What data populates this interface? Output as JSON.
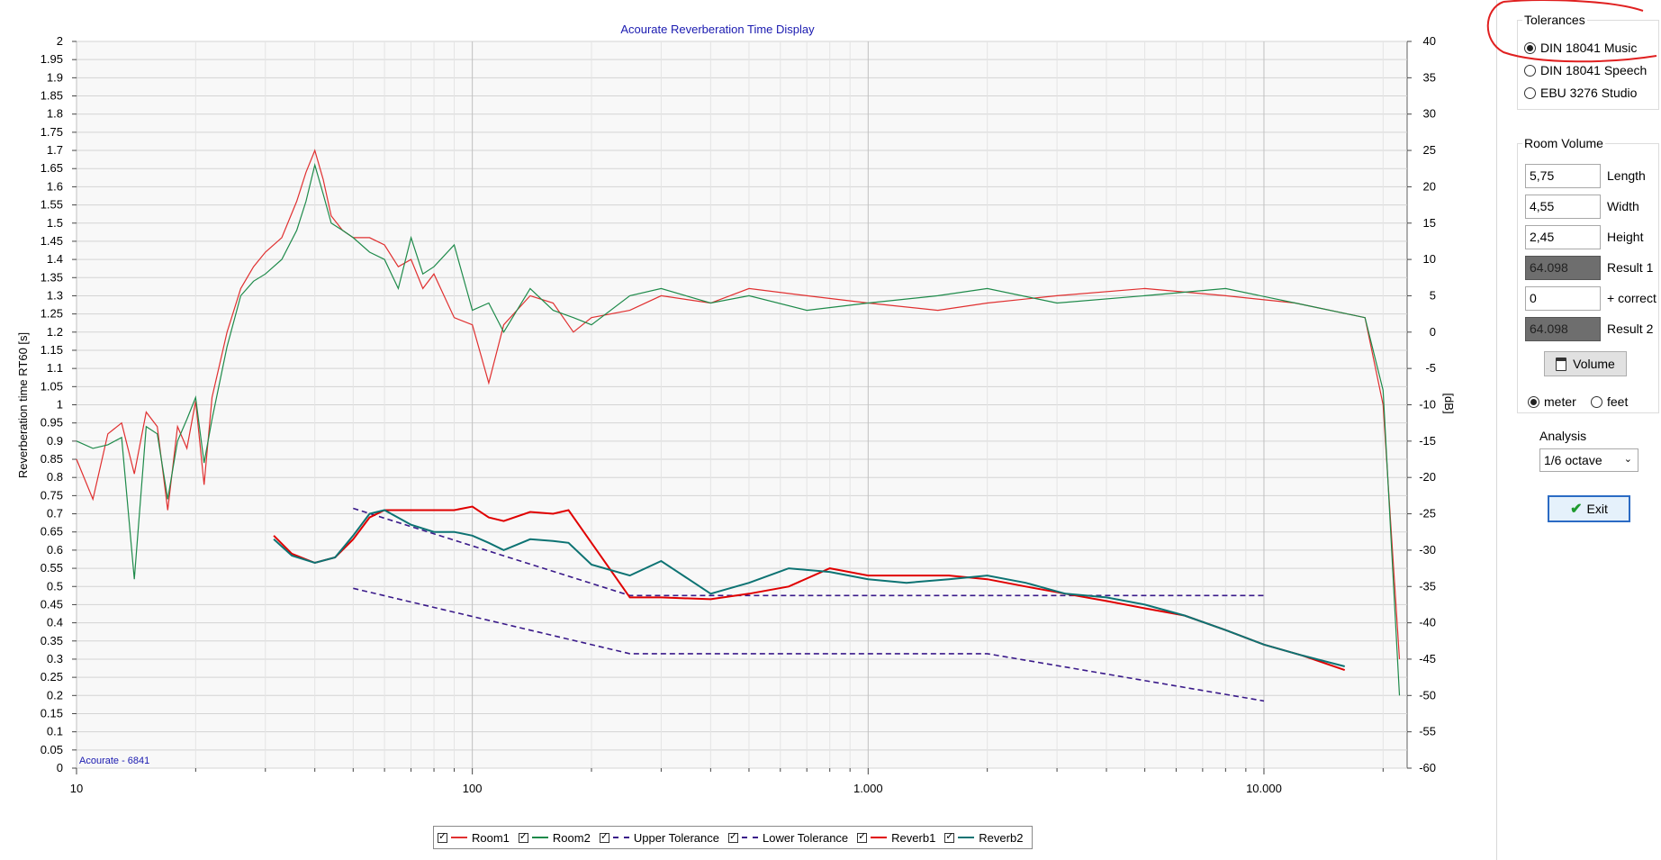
{
  "chart_data": {
    "type": "line",
    "title": "Acourate Reverberation Time Display",
    "watermark": "Acourate - 6841",
    "xscale": "log",
    "xlim": [
      10,
      23000
    ],
    "x_ticks": [
      10,
      100,
      1000,
      10000
    ],
    "x_tick_labels": [
      "10",
      "100",
      "1.000",
      "10.000"
    ],
    "ylabel": "Reverberation time RT60 [s]",
    "ylim": [
      0,
      2
    ],
    "y_ticks": [
      "0",
      "0.05",
      "0.1",
      "0.15",
      "0.2",
      "0.25",
      "0.3",
      "0.35",
      "0.4",
      "0.45",
      "0.5",
      "0.55",
      "0.6",
      "0.65",
      "0.7",
      "0.75",
      "0.8",
      "0.85",
      "0.9",
      "0.95",
      "1",
      "1.05",
      "1.1",
      "1.15",
      "1.2",
      "1.25",
      "1.3",
      "1.35",
      "1.4",
      "1.45",
      "1.5",
      "1.55",
      "1.6",
      "1.65",
      "1.7",
      "1.75",
      "1.8",
      "1.85",
      "1.9",
      "1.95",
      "2"
    ],
    "y2label": "[dB]",
    "y2lim": [
      -60,
      40
    ],
    "y2_ticks": [
      "40",
      "35",
      "30",
      "25",
      "20",
      "15",
      "10",
      "5",
      "0",
      "-5",
      "-10",
      "-15",
      "-20",
      "-25",
      "-30",
      "-35",
      "-40",
      "-45",
      "-50",
      "-55",
      "-60"
    ],
    "grid": true,
    "legend_position": "bottom",
    "series": [
      {
        "name": "Room1",
        "color": "#e03030",
        "style": "solid",
        "axis": "y2",
        "x": [
          10,
          11,
          12,
          13,
          14,
          15,
          16,
          17,
          18,
          19,
          20,
          21,
          22,
          24,
          26,
          28,
          30,
          33,
          36,
          38,
          40,
          42,
          44,
          47,
          50,
          55,
          60,
          65,
          70,
          75,
          80,
          90,
          100,
          110,
          120,
          140,
          160,
          180,
          200,
          250,
          300,
          400,
          500,
          700,
          1000,
          1500,
          2000,
          3000,
          5000,
          8000,
          12000,
          18000,
          20000,
          22000
        ],
        "y": [
          -17.5,
          -23,
          -14,
          -12.5,
          -19.5,
          -11,
          -13,
          -24.5,
          -13,
          -16,
          -9.5,
          -21,
          -9,
          0,
          6,
          9,
          11,
          13,
          18,
          22,
          25,
          21,
          16,
          14,
          13,
          13,
          12,
          9,
          10,
          6,
          8,
          2,
          1,
          -7,
          1,
          5,
          4,
          0,
          2,
          3,
          5,
          4,
          6,
          5,
          4,
          3,
          4,
          5,
          6,
          5,
          4,
          2,
          -10,
          -45
        ]
      },
      {
        "name": "Room2",
        "color": "#1e8a4a",
        "style": "solid",
        "axis": "y2",
        "x": [
          10,
          11,
          12,
          13,
          14,
          15,
          16,
          17,
          18,
          19,
          20,
          21,
          22,
          24,
          26,
          28,
          30,
          33,
          36,
          38,
          40,
          42,
          44,
          47,
          50,
          55,
          60,
          65,
          70,
          75,
          80,
          90,
          100,
          110,
          120,
          140,
          160,
          180,
          200,
          250,
          300,
          400,
          500,
          700,
          1000,
          1500,
          2000,
          3000,
          5000,
          8000,
          12000,
          18000,
          20000,
          22000
        ],
        "y": [
          -15,
          -16,
          -15.5,
          -14.5,
          -34,
          -13,
          -14,
          -23,
          -15,
          -12,
          -9,
          -18,
          -12,
          -2,
          5,
          7,
          8,
          10,
          14,
          18,
          23,
          19,
          15,
          14,
          13,
          11,
          10,
          6,
          13,
          8,
          9,
          12,
          3,
          4,
          0,
          6,
          3,
          2,
          1,
          5,
          6,
          4,
          5,
          3,
          4,
          5,
          6,
          4,
          5,
          6,
          4,
          2,
          -8,
          -50
        ]
      },
      {
        "name": "Upper Tolerance",
        "color": "#3a1a8a",
        "style": "dashed",
        "axis": "y1",
        "x": [
          50,
          250,
          10000
        ],
        "y": [
          0.715,
          0.475,
          0.475
        ]
      },
      {
        "name": "Lower Tolerance",
        "color": "#3a1a8a",
        "style": "dashed",
        "axis": "y1",
        "x": [
          50,
          250,
          2000,
          10000
        ],
        "y": [
          0.495,
          0.315,
          0.315,
          0.185
        ]
      },
      {
        "name": "Reverb1",
        "color": "#e00000",
        "style": "solid",
        "axis": "y1",
        "x": [
          31.5,
          35,
          40,
          45,
          50,
          55,
          60,
          70,
          80,
          90,
          100,
          110,
          120,
          140,
          160,
          175,
          200,
          250,
          300,
          400,
          500,
          630,
          800,
          1000,
          1250,
          1600,
          2000,
          2500,
          3150,
          4000,
          5000,
          6300,
          8000,
          10000,
          12500,
          16000
        ],
        "y": [
          0.64,
          0.59,
          0.565,
          0.58,
          0.63,
          0.69,
          0.71,
          0.71,
          0.71,
          0.71,
          0.72,
          0.69,
          0.68,
          0.705,
          0.7,
          0.71,
          0.62,
          0.47,
          0.47,
          0.465,
          0.48,
          0.5,
          0.55,
          0.53,
          0.53,
          0.53,
          0.52,
          0.5,
          0.48,
          0.46,
          0.44,
          0.42,
          0.38,
          0.34,
          0.31,
          0.27
        ]
      },
      {
        "name": "Reverb2",
        "color": "#0d7373",
        "style": "solid",
        "axis": "y1",
        "x": [
          31.5,
          35,
          40,
          45,
          50,
          55,
          60,
          70,
          80,
          90,
          100,
          110,
          120,
          140,
          160,
          175,
          200,
          250,
          300,
          400,
          500,
          630,
          800,
          1000,
          1250,
          1600,
          2000,
          2500,
          3150,
          4000,
          5000,
          6300,
          8000,
          10000,
          12500,
          16000
        ],
        "y": [
          0.63,
          0.585,
          0.565,
          0.58,
          0.64,
          0.7,
          0.71,
          0.67,
          0.65,
          0.65,
          0.64,
          0.62,
          0.6,
          0.63,
          0.625,
          0.62,
          0.56,
          0.53,
          0.57,
          0.48,
          0.51,
          0.55,
          0.54,
          0.52,
          0.51,
          0.52,
          0.53,
          0.51,
          0.48,
          0.47,
          0.45,
          0.42,
          0.38,
          0.34,
          0.31,
          0.28
        ]
      }
    ]
  },
  "legend": {
    "items": [
      {
        "label": "Room1",
        "color": "#e03030",
        "dash": "solid"
      },
      {
        "label": "Room2",
        "color": "#1e8a4a",
        "dash": "solid"
      },
      {
        "label": "Upper Tolerance",
        "color": "#3a1a8a",
        "dash": "dashed"
      },
      {
        "label": "Lower Tolerance",
        "color": "#3a1a8a",
        "dash": "dashed"
      },
      {
        "label": "Reverb1",
        "color": "#e00000",
        "dash": "solid"
      },
      {
        "label": "Reverb2",
        "color": "#0d7373",
        "dash": "solid"
      }
    ]
  },
  "tolerances": {
    "title": "Tolerances",
    "options": [
      {
        "label": "DIN 18041 Music",
        "selected": true
      },
      {
        "label": "DIN 18041 Speech",
        "selected": false
      },
      {
        "label": "EBU 3276 Studio",
        "selected": false
      }
    ]
  },
  "room_volume": {
    "title": "Room Volume",
    "length": {
      "value": "5,75",
      "label": "Length"
    },
    "width": {
      "value": "4,55",
      "label": "Width"
    },
    "height": {
      "value": "2,45",
      "label": "Height"
    },
    "result1": {
      "value": "64.098",
      "label": "Result 1"
    },
    "correct": {
      "value": "0",
      "label": "+ correct"
    },
    "result2": {
      "value": "64.098",
      "label": "Result 2"
    },
    "volume_button": "Volume",
    "unit_meter": "meter",
    "unit_feet": "feet",
    "unit_selected": "meter"
  },
  "analysis": {
    "title": "Analysis",
    "selected": "1/6 octave"
  },
  "exit_button": "Exit",
  "colors": {
    "annotation": "#e02020",
    "exit_border": "#2b6bc4",
    "exit_check": "#1e9a2e"
  }
}
